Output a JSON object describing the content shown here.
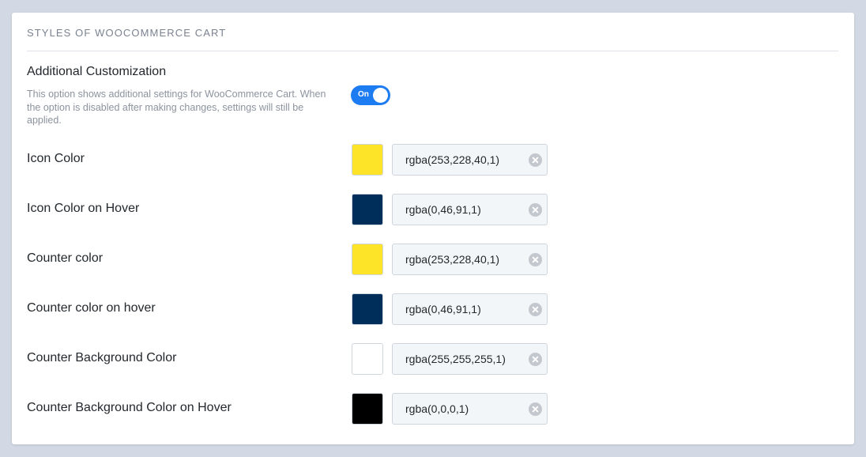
{
  "section": {
    "title": "STYLES OF WOOCOMMERCE CART"
  },
  "additional_customization": {
    "title": "Additional Customization",
    "description": "This option shows additional settings for WooCommerce Cart. When the option is disabled after making changes, settings will still be applied.",
    "toggle_label": "On",
    "enabled": true
  },
  "rows": [
    {
      "label": "Icon Color",
      "value": "rgba(253,228,40,1)",
      "swatch": "#fde428"
    },
    {
      "label": "Icon Color on Hover",
      "value": "rgba(0,46,91,1)",
      "swatch": "#002e5b"
    },
    {
      "label": "Counter color",
      "value": "rgba(253,228,40,1)",
      "swatch": "#fde428"
    },
    {
      "label": "Counter color on hover",
      "value": "rgba(0,46,91,1)",
      "swatch": "#002e5b"
    },
    {
      "label": "Counter Background Color",
      "value": "rgba(255,255,255,1)",
      "swatch": "#ffffff"
    },
    {
      "label": "Counter Background Color on Hover",
      "value": "rgba(0,0,0,1)",
      "swatch": "#000000"
    }
  ],
  "colors": {
    "accent": "#1e7cf2",
    "clear_icon": "#c3c8cf"
  },
  "icons": {
    "clear": "clear-circle-x-icon"
  }
}
